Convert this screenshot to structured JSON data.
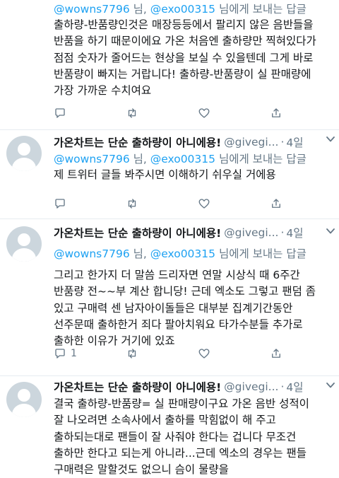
{
  "tweets": [
    {
      "replying": {
        "user1": "@wowns7796",
        "joiner": "님,",
        "user2": "@exo00315",
        "suffix": "님에게 보내는 답글"
      },
      "lines": [
        "출하량-반품량인것은 매장등등에서 팔리지 않은 음반들을",
        "반품을 하기 때문이에요 가온 처음엔 출하량만 찍혀있다가",
        "점점 숫자가 줄어드는 현상을 보실 수 있을텐데 그게 바로",
        "반품량이 빠지는 거랍니다! 출하량-반품량이 실 판매량에",
        "가장 가까운 수치여요"
      ],
      "actions": {
        "reply_count": "",
        "retweet_count": "",
        "like_count": ""
      }
    },
    {
      "name": "가온차트는 단순 출하량이 아니에용!",
      "handle": "@givegi...",
      "separator": "·",
      "time": "4일",
      "replying": {
        "user1": "@wowns7796",
        "joiner": "님,",
        "user2": "@exo00315",
        "suffix": "님에게 보내는 답글"
      },
      "lines": [
        "제 트위터 글들 봐주시면 이해하기 쉬우실 거에용"
      ],
      "actions": {
        "reply_count": "",
        "retweet_count": "",
        "like_count": ""
      }
    },
    {
      "name": "가온차트는 단순 출하량이 아니에용!",
      "handle": "@givegi...",
      "separator": "·",
      "time": "4일",
      "replying": {
        "user1": "@wowns7796",
        "joiner": "님,",
        "user2": "@exo00315",
        "suffix": "님에게 보내는 답글"
      },
      "lines": [
        "그리고 한가지 더 말씀 드리자면 연말 시상식 때 6주간",
        "반품량 전~~부 계산 합니당! 근데 엑소도 그렇고 팬덤 좀",
        "있고 구매력 센 남자아이돌들은 대부분 집계기간동안",
        "선주문때 출하한거 죄다 팔아치워요 타가수분들 추가로",
        "출하한 이유가 거기에 있죠"
      ],
      "actions": {
        "reply_count": "1",
        "retweet_count": "",
        "like_count": ""
      }
    },
    {
      "name": "가온차트는 단순 출하량이 아니에용!",
      "handle": "@givegi...",
      "separator": "·",
      "time": "4일",
      "lines": [
        "결국 출하량-반품량= 실 판매량이구요 가온 음반 성적이",
        "잘 나오려면 소속사에서 출하를 막힘없이 해 주고",
        "출하되는대로 팬들이 잘 사줘야 한다는 겁니다 무조건",
        "출하만 한다고 되는게 아니라...근데 엑소의 경우는 팬들",
        "구매력은 말할것도 없으니 슴이 물량을"
      ]
    }
  ],
  "colors": {
    "link": "#1da1f2",
    "muted": "#657786",
    "text": "#14171a",
    "divider": "#e6ecf0",
    "avatar": "#ccd6dd"
  },
  "icons": {
    "reply": "reply-icon",
    "retweet": "retweet-icon",
    "like": "heart-icon",
    "share": "share-icon",
    "caret": "chevron-down-icon"
  }
}
